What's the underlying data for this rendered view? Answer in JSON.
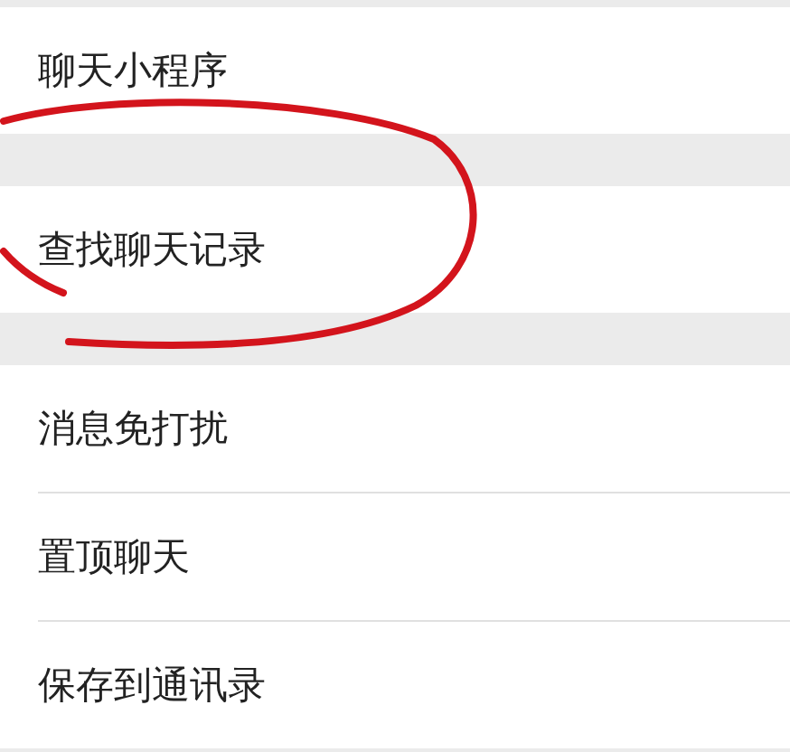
{
  "groups": [
    {
      "items": [
        {
          "label": "聊天小程序",
          "circled": false
        }
      ]
    },
    {
      "items": [
        {
          "label": "查找聊天记录",
          "circled": true
        }
      ]
    },
    {
      "items": [
        {
          "label": "消息免打扰",
          "circled": false
        },
        {
          "label": "置顶聊天",
          "circled": false
        },
        {
          "label": "保存到通讯录",
          "circled": false
        }
      ]
    }
  ]
}
